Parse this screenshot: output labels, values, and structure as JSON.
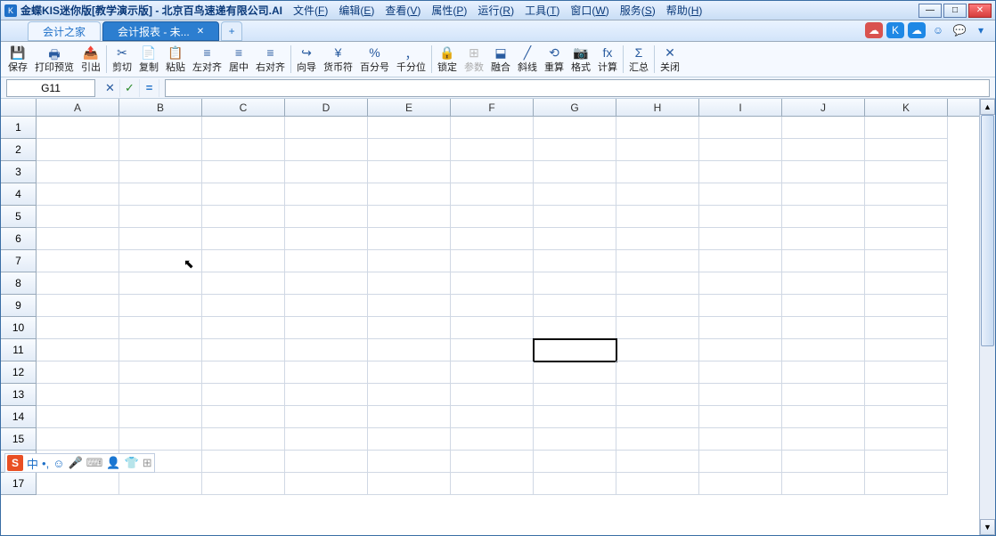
{
  "title": "金蝶KIS迷你版[教学演示版] - 北京百鸟速递有限公司.AI",
  "menus": [
    {
      "label": "文件",
      "key": "F"
    },
    {
      "label": "编辑",
      "key": "E"
    },
    {
      "label": "查看",
      "key": "V"
    },
    {
      "label": "属性",
      "key": "P"
    },
    {
      "label": "运行",
      "key": "R"
    },
    {
      "label": "工具",
      "key": "T"
    },
    {
      "label": "窗口",
      "key": "W"
    },
    {
      "label": "服务",
      "key": "S"
    },
    {
      "label": "帮助",
      "key": "H"
    }
  ],
  "tabs": {
    "inactive": "会计之家",
    "active": "会计报表 - 未...",
    "new": "+"
  },
  "toolbar": [
    {
      "icon": "💾",
      "label": "保存",
      "name": "tb-save"
    },
    {
      "icon": "🖶",
      "label": "打印预览",
      "name": "tb-print-preview"
    },
    {
      "icon": "📤",
      "label": "引出",
      "name": "tb-export"
    },
    {
      "sep": true
    },
    {
      "icon": "✂",
      "label": "剪切",
      "name": "tb-cut"
    },
    {
      "icon": "📄",
      "label": "复制",
      "name": "tb-copy"
    },
    {
      "icon": "📋",
      "label": "粘贴",
      "name": "tb-paste"
    },
    {
      "icon": "≡",
      "label": "左对齐",
      "name": "tb-align-left"
    },
    {
      "icon": "≡",
      "label": "居中",
      "name": "tb-align-center"
    },
    {
      "icon": "≡",
      "label": "右对齐",
      "name": "tb-align-right"
    },
    {
      "sep": true
    },
    {
      "icon": "↪",
      "label": "向导",
      "name": "tb-wizard"
    },
    {
      "icon": "¥",
      "label": "货币符",
      "name": "tb-currency"
    },
    {
      "icon": "%",
      "label": "百分号",
      "name": "tb-percent"
    },
    {
      "icon": "，",
      "label": "千分位",
      "name": "tb-thousand"
    },
    {
      "sep": true
    },
    {
      "icon": "🔒",
      "label": "锁定",
      "name": "tb-lock"
    },
    {
      "icon": "⊞",
      "label": "参数",
      "name": "tb-params",
      "disabled": true
    },
    {
      "icon": "⬓",
      "label": "融合",
      "name": "tb-merge"
    },
    {
      "icon": "╱",
      "label": "斜线",
      "name": "tb-diagonal"
    },
    {
      "icon": "⟲",
      "label": "重算",
      "name": "tb-recalc"
    },
    {
      "icon": "📷",
      "label": "格式",
      "name": "tb-format"
    },
    {
      "icon": "fx",
      "label": "计算",
      "name": "tb-compute"
    },
    {
      "sep": true
    },
    {
      "icon": "Σ",
      "label": "汇总",
      "name": "tb-summary"
    },
    {
      "sep": true
    },
    {
      "icon": "✕",
      "label": "关闭",
      "name": "tb-close"
    }
  ],
  "formula_bar": {
    "cell_ref": "G11",
    "value": ""
  },
  "columns": [
    "A",
    "B",
    "C",
    "D",
    "E",
    "F",
    "G",
    "H",
    "I",
    "J",
    "K"
  ],
  "row_count": 17,
  "selected_cell": {
    "row": 11,
    "col": "G"
  },
  "ime": [
    "中",
    "•,",
    "☺",
    "🎤",
    "⌨",
    "👤",
    "👕",
    "⊞"
  ],
  "tabbar_icons": [
    {
      "bg": "#d9534f",
      "glyph": "☁"
    },
    {
      "bg": "#1e88e5",
      "glyph": "K"
    },
    {
      "bg": "#1e88e5",
      "glyph": "☁"
    },
    {
      "bg": "transparent",
      "glyph": "☺",
      "fg": "#1e70c8"
    },
    {
      "bg": "transparent",
      "glyph": "💬",
      "fg": "#1e70c8"
    },
    {
      "bg": "transparent",
      "glyph": "▾",
      "fg": "#1e70c8"
    }
  ]
}
